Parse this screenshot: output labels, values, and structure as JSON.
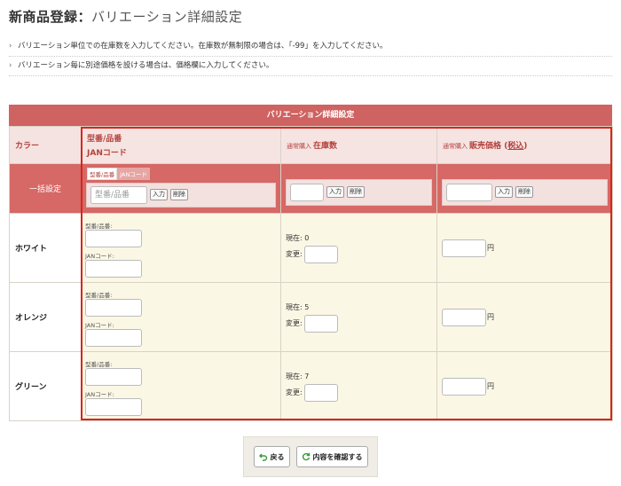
{
  "title": {
    "main": "新商品登録",
    "sep": "：",
    "sub": "バリエーション詳細設定"
  },
  "notes": [
    "バリエーション単位での在庫数を入力してください。在庫数が無制限の場合は、「-99」を入力してください。",
    "バリエーション毎に別途価格を設ける場合は、価格欄に入力してください。"
  ],
  "table": {
    "banner": "バリエーション詳細設定",
    "headers": {
      "color": "カラー",
      "code_line1": "型番/品番",
      "code_line2": "JANコード",
      "stock_prefix": "通常購入",
      "stock": "在庫数",
      "price_prefix": "通常購入",
      "price": "販売価格",
      "price_paren_open": "(",
      "price_tax": "税込",
      "price_paren_close": ")"
    },
    "bulk": {
      "label": "一括設定",
      "tab_active": "型番/品番",
      "tab_inactive": "JANコード",
      "code_placeholder": "型番/品番",
      "input_label": "入力",
      "delete_label": "削除"
    },
    "field_labels": {
      "code": "型番/品番:",
      "jan": "JANコード:",
      "current_prefix": "現在: ",
      "change": "変更:",
      "yen": "円"
    },
    "rows": [
      {
        "name": "ホワイト",
        "current": "0"
      },
      {
        "name": "オレンジ",
        "current": "5"
      },
      {
        "name": "グリーン",
        "current": "7"
      }
    ]
  },
  "footer": {
    "back": "戻る",
    "confirm": "内容を確認する"
  },
  "colors": {
    "accent": "#cf6361",
    "highlight": "#d8261c",
    "row_bg": "#fbf7e5"
  }
}
